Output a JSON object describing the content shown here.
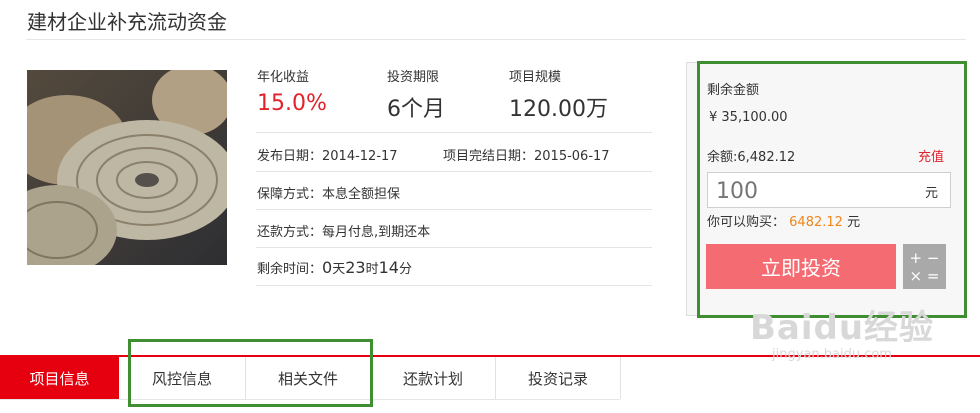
{
  "page": {
    "title": "建材企业补充流动资金"
  },
  "stats": [
    {
      "label": "年化收益",
      "value": "15.0%"
    },
    {
      "label": "投资期限",
      "value": "6个月"
    },
    {
      "label": "项目规模",
      "value": "120.00万"
    }
  ],
  "details": {
    "publish_date": "发布日期：2014-12-17",
    "end_date": "项目完结日期：2015-06-17",
    "guarantee": "保障方式：本息全额担保",
    "repayment": "还款方式：每月付息,到期还本",
    "remaining_label": "剩余时间：",
    "remaining_days": "0",
    "days_unit": "天",
    "remaining_hours": "23",
    "hours_unit": "时",
    "remaining_minutes": "14",
    "minutes_unit": "分"
  },
  "invest_panel": {
    "remaining_label": "剩余金额",
    "remaining_amount": "¥ 35,100.00",
    "balance": "余额:6,482.12",
    "recharge": "充值",
    "amount_placeholder": "100",
    "unit": "元",
    "can_buy_prefix": "你可以购买：",
    "can_buy_amount": "6482.12",
    "can_buy_unit": "元",
    "invest_button": "立即投资",
    "calc_symbols_top": "+ −",
    "calc_symbols_bottom": "× ="
  },
  "tabs": [
    {
      "label": "项目信息"
    },
    {
      "label": "风控信息"
    },
    {
      "label": "相关文件"
    },
    {
      "label": "还款计划"
    },
    {
      "label": "投资记录"
    }
  ],
  "watermark": {
    "brand": "Baidu经验",
    "url": "jingyan.baidu.com"
  },
  "colors": {
    "accent_red": "#e6000f",
    "highlight_green": "#3f8f32",
    "button_pink": "#f46b72",
    "orange": "#f08519"
  }
}
